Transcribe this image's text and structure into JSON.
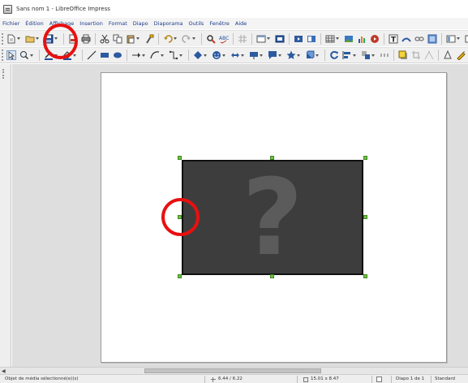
{
  "window": {
    "title": "Sans nom 1 - LibreOffice Impress"
  },
  "menubar": {
    "items": [
      "Fichier",
      "Édition",
      "Affichage",
      "Insertion",
      "Format",
      "Diapo",
      "Diaporama",
      "Outils",
      "Fenêtre",
      "Aide"
    ]
  },
  "toolbar_standard": {
    "icons": [
      "new-document-icon",
      "open-folder-icon",
      "save-icon",
      "export-pdf-icon",
      "print-icon",
      "cut-icon",
      "copy-icon",
      "paste-icon",
      "clone-formatting-icon",
      "undo-icon",
      "redo-icon",
      "find-replace-icon",
      "spelling-icon",
      "grid-icon",
      "display-views-icon",
      "slide-icon",
      "start-slideshow-icon",
      "table-icon",
      "image-icon",
      "chart-icon",
      "media-icon",
      "textbox-icon",
      "fontwork-icon",
      "hyperlink-icon",
      "navigator-icon",
      "slide-pane-icon"
    ]
  },
  "toolbar_drawing": {
    "icons": [
      "select-icon",
      "zoom-icon",
      "line-color-icon",
      "fill-color-icon",
      "line-icon",
      "rectangle-icon",
      "ellipse-icon",
      "arrow-line-icon",
      "curve-icon",
      "connector-icon",
      "basic-shapes-icon",
      "symbol-shapes-icon",
      "block-arrows-icon",
      "flowchart-icon",
      "callouts-icon",
      "stars-icon",
      "3d-objects-icon",
      "rotate-icon",
      "align-icon",
      "arrange-icon",
      "distribute-icon",
      "shadow-icon",
      "crop-icon",
      "points-icon",
      "glue-points-icon",
      "toggle-extrusion-icon"
    ]
  },
  "slide": {
    "media_placeholder": "?"
  },
  "statusbar": {
    "selection": "Objet de média sélectionné(e)(s)",
    "position": "6.44 / 6.22",
    "size": "15.01 x 8.47",
    "slide": "Diapo 1 de 1",
    "layout": "Standard"
  },
  "colors": {
    "highlight": "#e81010",
    "handles": "#6fbf44",
    "media_fill": "#3d3d3d"
  }
}
